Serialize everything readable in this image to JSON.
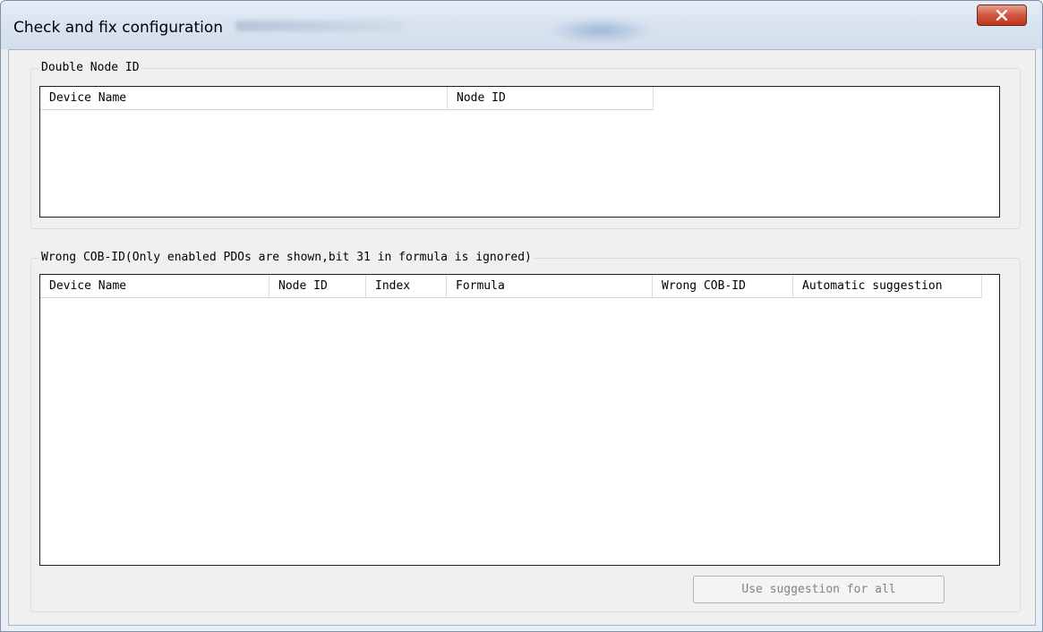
{
  "window": {
    "title": "Check and fix configuration",
    "close_glyph": "✕"
  },
  "double_node": {
    "group_label": "Double Node ID",
    "columns": [
      "Device Name",
      "Node ID"
    ],
    "rows": []
  },
  "wrong_cob": {
    "group_label": "Wrong COB-ID(Only enabled PDOs are shown,bit 31 in formula is ignored)",
    "columns": [
      "Device Name",
      "Node ID",
      "Index",
      "Formula",
      "Wrong COB-ID",
      "Automatic suggestion"
    ],
    "rows": []
  },
  "buttons": {
    "use_suggestion_label": "Use suggestion for all",
    "use_suggestion_enabled": false
  },
  "icons": {
    "close": "close-icon"
  },
  "colors": {
    "close_button": "#c0361f",
    "dialog_face": "#f0f0f0",
    "disabled_text": "#838383"
  }
}
